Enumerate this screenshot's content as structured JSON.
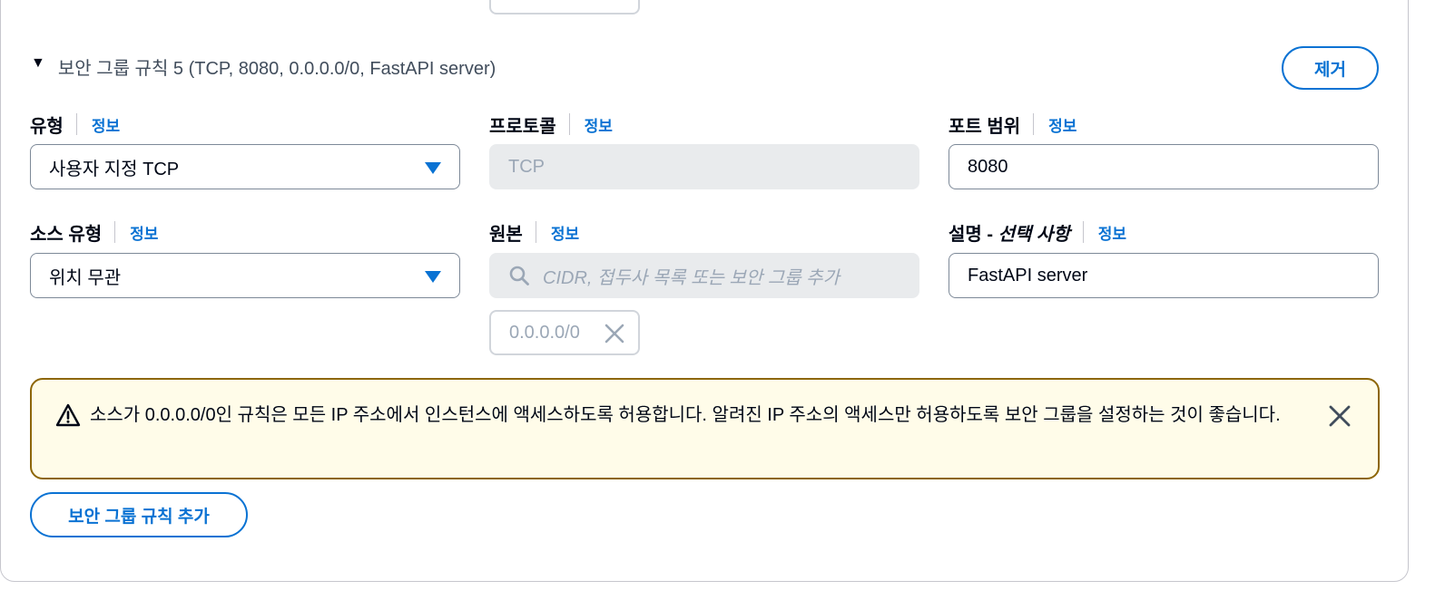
{
  "rule": {
    "header": "보안 그룹 규칙 5 (TCP, 8080, 0.0.0.0/0, FastAPI server)",
    "remove_label": "제거"
  },
  "fields": {
    "type": {
      "label": "유형",
      "info": "정보",
      "value": "사용자 지정 TCP"
    },
    "protocol": {
      "label": "프로토콜",
      "info": "정보",
      "value": "TCP"
    },
    "port_range": {
      "label": "포트 범위",
      "info": "정보",
      "value": "8080"
    },
    "source_type": {
      "label": "소스 유형",
      "info": "정보",
      "value": "위치 무관"
    },
    "source": {
      "label": "원본",
      "info": "정보",
      "placeholder": "CIDR, 접두사 목록 또는 보안 그룹 추가",
      "token": "0.0.0.0/0"
    },
    "description": {
      "label": "설명 - ",
      "label_optional": "선택 사항",
      "info": "정보",
      "value": "FastAPI server"
    }
  },
  "alert": {
    "message": "소스가 0.0.0.0/0인 규칙은 모든 IP 주소에서 인스턴스에 액세스하도록 허용합니다. 알려진 IP 주소의 액세스만 허용하도록 보안 그룹을 설정하는 것이 좋습니다."
  },
  "add_rule_label": "보안 그룹 규칙 추가",
  "colors": {
    "accent": "#0972d3",
    "warning_border": "#8d6605",
    "warning_bg": "#fffce9",
    "disabled_bg": "#e9ebed"
  }
}
